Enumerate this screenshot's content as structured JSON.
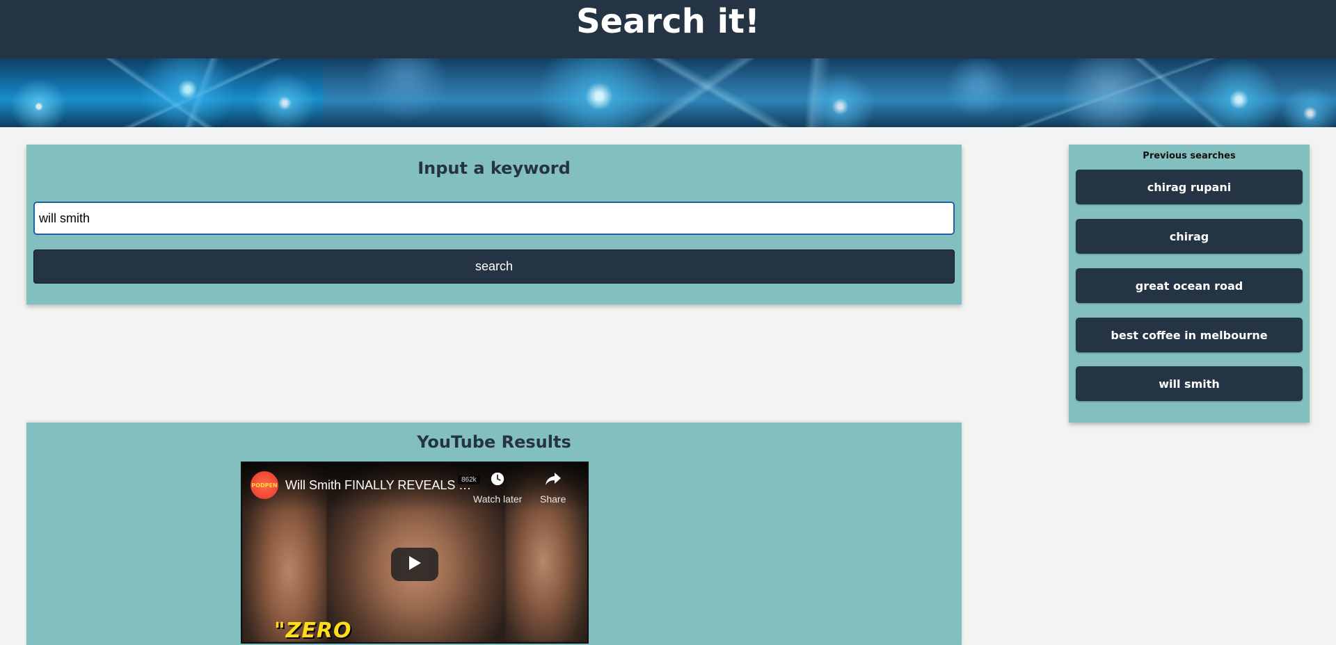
{
  "header": {
    "title": "Search it!"
  },
  "search": {
    "heading": "Input a keyword",
    "input_value": "will smith",
    "button_label": "search"
  },
  "history": {
    "heading": "Previous searches",
    "items": [
      {
        "label": "chirag rupani"
      },
      {
        "label": "chirag"
      },
      {
        "label": "great ocean road"
      },
      {
        "label": "best coffee in melbourne"
      },
      {
        "label": "will smith"
      }
    ]
  },
  "youtube": {
    "heading": "YouTube Results",
    "video": {
      "title": "Will Smith FINALLY REVEALS T...",
      "channel_badge": "PODPEN",
      "view_count": "862k",
      "watch_later_label": "Watch later",
      "share_label": "Share",
      "caption": "\"ZERO"
    }
  },
  "colors": {
    "header_bg": "#253444",
    "panel_bg": "#83bfbf",
    "button_bg": "#253444",
    "page_bg": "#f2f3f2"
  },
  "icons": {
    "watch_later": "clock-icon",
    "share": "share-arrow-icon",
    "play": "play-icon"
  }
}
